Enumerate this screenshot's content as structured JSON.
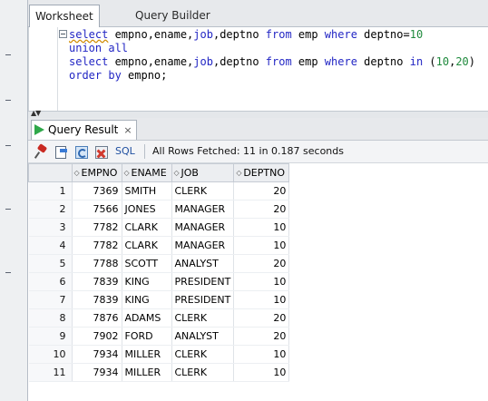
{
  "worksheet_tabs": [
    {
      "label": "Worksheet"
    },
    {
      "label": "Query Builder"
    }
  ],
  "editor": {
    "lines": [
      [
        {
          "t": "select",
          "k": "kw"
        },
        {
          "t": " empno,ename,",
          "k": ""
        },
        {
          "t": "job",
          "k": "kw"
        },
        {
          "t": ",deptno ",
          "k": ""
        },
        {
          "t": "from",
          "k": "kw"
        },
        {
          "t": " emp ",
          "k": ""
        },
        {
          "t": "where",
          "k": "kw"
        },
        {
          "t": " deptno=",
          "k": ""
        },
        {
          "t": "10",
          "k": "num"
        }
      ],
      [
        {
          "t": "union all",
          "k": "kw"
        }
      ],
      [
        {
          "t": "select",
          "k": "kw"
        },
        {
          "t": " empno,ename,",
          "k": ""
        },
        {
          "t": "job",
          "k": "kw"
        },
        {
          "t": ",deptno ",
          "k": ""
        },
        {
          "t": "from",
          "k": "kw"
        },
        {
          "t": " emp ",
          "k": ""
        },
        {
          "t": "where",
          "k": "kw"
        },
        {
          "t": " deptno ",
          "k": ""
        },
        {
          "t": "in",
          "k": "kw"
        },
        {
          "t": " (",
          "k": ""
        },
        {
          "t": "10",
          "k": "num"
        },
        {
          "t": ",",
          "k": ""
        },
        {
          "t": "20",
          "k": "num"
        },
        {
          "t": ")",
          "k": ""
        }
      ],
      [
        {
          "t": "order by",
          "k": "kw"
        },
        {
          "t": " empno;",
          "k": ""
        }
      ]
    ],
    "colors": {
      "keyword": "#2226c4",
      "number": "#1f8a3d"
    }
  },
  "result_panel": {
    "tab_label": "Query Result",
    "close_glyph": "×",
    "toolbar": {
      "icons": [
        "pin-icon",
        "export-icon",
        "refresh-icon",
        "cancel-icon"
      ],
      "sql_label": "SQL",
      "status_text": "All Rows Fetched: 11 in 0.187 seconds"
    },
    "columns": [
      "EMPNO",
      "ENAME",
      "JOB",
      "DEPTNO"
    ],
    "rows": [
      {
        "n": "1",
        "empno": "7369",
        "ename": "SMITH",
        "job": "CLERK",
        "deptno": "20"
      },
      {
        "n": "2",
        "empno": "7566",
        "ename": "JONES",
        "job": "MANAGER",
        "deptno": "20"
      },
      {
        "n": "3",
        "empno": "7782",
        "ename": "CLARK",
        "job": "MANAGER",
        "deptno": "10"
      },
      {
        "n": "4",
        "empno": "7782",
        "ename": "CLARK",
        "job": "MANAGER",
        "deptno": "10"
      },
      {
        "n": "5",
        "empno": "7788",
        "ename": "SCOTT",
        "job": "ANALYST",
        "deptno": "20"
      },
      {
        "n": "6",
        "empno": "7839",
        "ename": "KING",
        "job": "PRESIDENT",
        "deptno": "10"
      },
      {
        "n": "7",
        "empno": "7839",
        "ename": "KING",
        "job": "PRESIDENT",
        "deptno": "10"
      },
      {
        "n": "8",
        "empno": "7876",
        "ename": "ADAMS",
        "job": "CLERK",
        "deptno": "20"
      },
      {
        "n": "9",
        "empno": "7902",
        "ename": "FORD",
        "job": "ANALYST",
        "deptno": "20"
      },
      {
        "n": "10",
        "empno": "7934",
        "ename": "MILLER",
        "job": "CLERK",
        "deptno": "10"
      },
      {
        "n": "11",
        "empno": "7934",
        "ename": "MILLER",
        "job": "CLERK",
        "deptno": "10"
      }
    ]
  }
}
